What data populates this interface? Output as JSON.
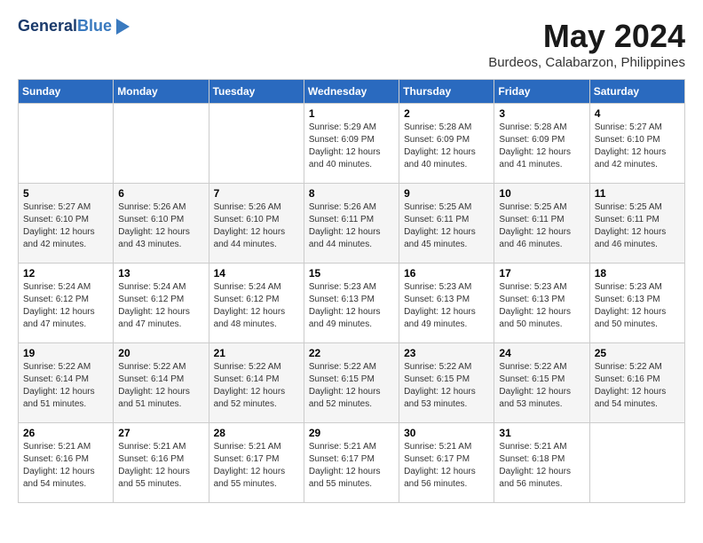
{
  "header": {
    "logo_line1": "General",
    "logo_line2": "Blue",
    "month_title": "May 2024",
    "subtitle": "Burdeos, Calabarzon, Philippines"
  },
  "weekdays": [
    "Sunday",
    "Monday",
    "Tuesday",
    "Wednesday",
    "Thursday",
    "Friday",
    "Saturday"
  ],
  "weeks": [
    [
      {
        "day": "",
        "info": ""
      },
      {
        "day": "",
        "info": ""
      },
      {
        "day": "",
        "info": ""
      },
      {
        "day": "1",
        "info": "Sunrise: 5:29 AM\nSunset: 6:09 PM\nDaylight: 12 hours\nand 40 minutes."
      },
      {
        "day": "2",
        "info": "Sunrise: 5:28 AM\nSunset: 6:09 PM\nDaylight: 12 hours\nand 40 minutes."
      },
      {
        "day": "3",
        "info": "Sunrise: 5:28 AM\nSunset: 6:09 PM\nDaylight: 12 hours\nand 41 minutes."
      },
      {
        "day": "4",
        "info": "Sunrise: 5:27 AM\nSunset: 6:10 PM\nDaylight: 12 hours\nand 42 minutes."
      }
    ],
    [
      {
        "day": "5",
        "info": "Sunrise: 5:27 AM\nSunset: 6:10 PM\nDaylight: 12 hours\nand 42 minutes."
      },
      {
        "day": "6",
        "info": "Sunrise: 5:26 AM\nSunset: 6:10 PM\nDaylight: 12 hours\nand 43 minutes."
      },
      {
        "day": "7",
        "info": "Sunrise: 5:26 AM\nSunset: 6:10 PM\nDaylight: 12 hours\nand 44 minutes."
      },
      {
        "day": "8",
        "info": "Sunrise: 5:26 AM\nSunset: 6:11 PM\nDaylight: 12 hours\nand 44 minutes."
      },
      {
        "day": "9",
        "info": "Sunrise: 5:25 AM\nSunset: 6:11 PM\nDaylight: 12 hours\nand 45 minutes."
      },
      {
        "day": "10",
        "info": "Sunrise: 5:25 AM\nSunset: 6:11 PM\nDaylight: 12 hours\nand 46 minutes."
      },
      {
        "day": "11",
        "info": "Sunrise: 5:25 AM\nSunset: 6:11 PM\nDaylight: 12 hours\nand 46 minutes."
      }
    ],
    [
      {
        "day": "12",
        "info": "Sunrise: 5:24 AM\nSunset: 6:12 PM\nDaylight: 12 hours\nand 47 minutes."
      },
      {
        "day": "13",
        "info": "Sunrise: 5:24 AM\nSunset: 6:12 PM\nDaylight: 12 hours\nand 47 minutes."
      },
      {
        "day": "14",
        "info": "Sunrise: 5:24 AM\nSunset: 6:12 PM\nDaylight: 12 hours\nand 48 minutes."
      },
      {
        "day": "15",
        "info": "Sunrise: 5:23 AM\nSunset: 6:13 PM\nDaylight: 12 hours\nand 49 minutes."
      },
      {
        "day": "16",
        "info": "Sunrise: 5:23 AM\nSunset: 6:13 PM\nDaylight: 12 hours\nand 49 minutes."
      },
      {
        "day": "17",
        "info": "Sunrise: 5:23 AM\nSunset: 6:13 PM\nDaylight: 12 hours\nand 50 minutes."
      },
      {
        "day": "18",
        "info": "Sunrise: 5:23 AM\nSunset: 6:13 PM\nDaylight: 12 hours\nand 50 minutes."
      }
    ],
    [
      {
        "day": "19",
        "info": "Sunrise: 5:22 AM\nSunset: 6:14 PM\nDaylight: 12 hours\nand 51 minutes."
      },
      {
        "day": "20",
        "info": "Sunrise: 5:22 AM\nSunset: 6:14 PM\nDaylight: 12 hours\nand 51 minutes."
      },
      {
        "day": "21",
        "info": "Sunrise: 5:22 AM\nSunset: 6:14 PM\nDaylight: 12 hours\nand 52 minutes."
      },
      {
        "day": "22",
        "info": "Sunrise: 5:22 AM\nSunset: 6:15 PM\nDaylight: 12 hours\nand 52 minutes."
      },
      {
        "day": "23",
        "info": "Sunrise: 5:22 AM\nSunset: 6:15 PM\nDaylight: 12 hours\nand 53 minutes."
      },
      {
        "day": "24",
        "info": "Sunrise: 5:22 AM\nSunset: 6:15 PM\nDaylight: 12 hours\nand 53 minutes."
      },
      {
        "day": "25",
        "info": "Sunrise: 5:22 AM\nSunset: 6:16 PM\nDaylight: 12 hours\nand 54 minutes."
      }
    ],
    [
      {
        "day": "26",
        "info": "Sunrise: 5:21 AM\nSunset: 6:16 PM\nDaylight: 12 hours\nand 54 minutes."
      },
      {
        "day": "27",
        "info": "Sunrise: 5:21 AM\nSunset: 6:16 PM\nDaylight: 12 hours\nand 55 minutes."
      },
      {
        "day": "28",
        "info": "Sunrise: 5:21 AM\nSunset: 6:17 PM\nDaylight: 12 hours\nand 55 minutes."
      },
      {
        "day": "29",
        "info": "Sunrise: 5:21 AM\nSunset: 6:17 PM\nDaylight: 12 hours\nand 55 minutes."
      },
      {
        "day": "30",
        "info": "Sunrise: 5:21 AM\nSunset: 6:17 PM\nDaylight: 12 hours\nand 56 minutes."
      },
      {
        "day": "31",
        "info": "Sunrise: 5:21 AM\nSunset: 6:18 PM\nDaylight: 12 hours\nand 56 minutes."
      },
      {
        "day": "",
        "info": ""
      }
    ]
  ]
}
